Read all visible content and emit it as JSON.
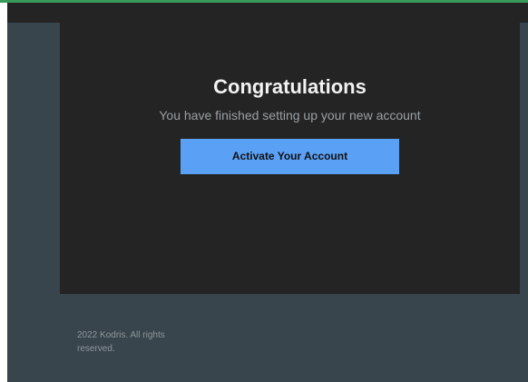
{
  "card": {
    "title": "Congratulations",
    "subtitle": "You have finished setting up your new account",
    "cta_label": "Activate Your Account"
  },
  "footer": {
    "copyright": "2022 Kodris. All rights reserved."
  },
  "colors": {
    "accent": "#5aa0f5",
    "card_background": "#242424",
    "page_background": "#38454c",
    "top_border": "#3a9a5a"
  }
}
